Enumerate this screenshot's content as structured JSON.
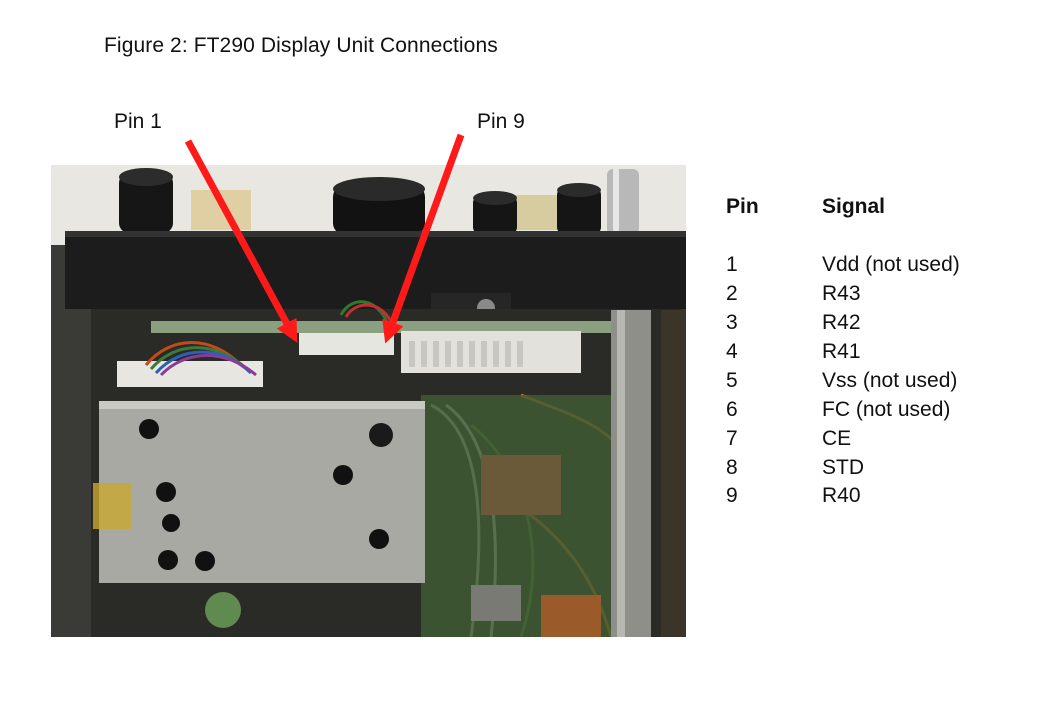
{
  "figure": {
    "title": "Figure 2: FT290 Display Unit Connections",
    "pin1_label": "Pin 1",
    "pin9_label": "Pin 9"
  },
  "table": {
    "headers": {
      "pin": "Pin",
      "signal": "Signal"
    },
    "rows": [
      {
        "pin": "1",
        "signal": "Vdd (not used)"
      },
      {
        "pin": "2",
        "signal": "R43"
      },
      {
        "pin": "3",
        "signal": "R42"
      },
      {
        "pin": "4",
        "signal": "R41"
      },
      {
        "pin": "5",
        "signal": "Vss (not used)"
      },
      {
        "pin": "6",
        "signal": "FC (not used)"
      },
      {
        "pin": "7",
        "signal": "CE"
      },
      {
        "pin": "8",
        "signal": "STD"
      },
      {
        "pin": "9",
        "signal": "R40"
      }
    ]
  },
  "colors": {
    "arrow": "#ff1a1a",
    "chassis": "#1c1c1c",
    "shield": "#a9a9a4",
    "pcb": "#4a6a3a"
  }
}
